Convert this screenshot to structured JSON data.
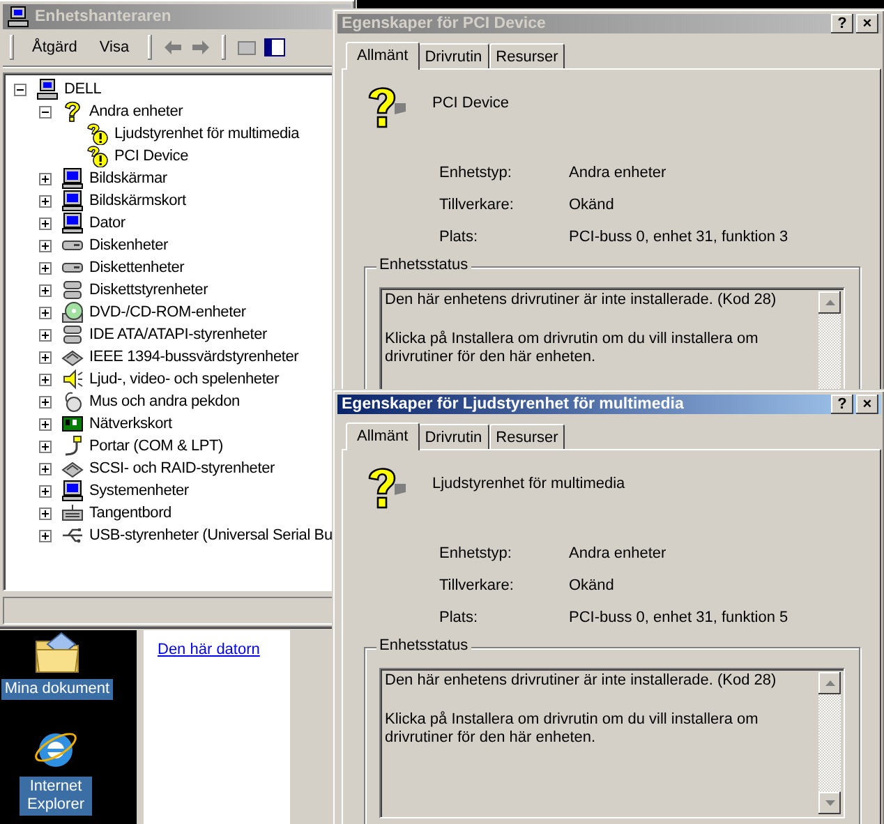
{
  "desktop_icons": [
    {
      "label": "Mina dokument",
      "kind": "documents",
      "selected": true
    },
    {
      "label": "Internet Explorer",
      "kind": "browser",
      "selected": true
    }
  ],
  "background_window": {
    "links": [
      "Den här datorn"
    ]
  },
  "device_manager": {
    "title": "Enhetshanteraren",
    "active": false,
    "menu": [
      "Åtgärd",
      "Visa"
    ],
    "tree": {
      "label": "DELL",
      "kind": "computer",
      "expanded": true,
      "children": [
        {
          "label": "Andra enheter",
          "kind": "question",
          "expanded": true,
          "children": [
            {
              "label": "Ljudstyrenhet för multimedia",
              "kind": "warning"
            },
            {
              "label": "PCI Device",
              "kind": "warning"
            }
          ]
        },
        {
          "label": "Bildskärmar",
          "kind": "monitor",
          "expanded": false
        },
        {
          "label": "Bildskärmskort",
          "kind": "monitor",
          "expanded": false
        },
        {
          "label": "Dator",
          "kind": "monitor",
          "expanded": false
        },
        {
          "label": "Diskenheter",
          "kind": "drive",
          "expanded": false
        },
        {
          "label": "Diskettenheter",
          "kind": "drive",
          "expanded": false
        },
        {
          "label": "Diskettstyrenheter",
          "kind": "controller",
          "expanded": false
        },
        {
          "label": "DVD-/CD-ROM-enheter",
          "kind": "disc",
          "expanded": false
        },
        {
          "label": "IDE ATA/ATAPI-styrenheter",
          "kind": "controller",
          "expanded": false
        },
        {
          "label": "IEEE 1394-bussvärdstyrenheter",
          "kind": "card",
          "expanded": false
        },
        {
          "label": "Ljud-, video- och spelenheter",
          "kind": "speaker",
          "expanded": false
        },
        {
          "label": "Mus och andra pekdon",
          "kind": "mouse",
          "expanded": false
        },
        {
          "label": "Nätverkskort",
          "kind": "network",
          "expanded": false
        },
        {
          "label": "Portar (COM & LPT)",
          "kind": "plug",
          "expanded": false
        },
        {
          "label": "SCSI- och RAID-styrenheter",
          "kind": "card",
          "expanded": false
        },
        {
          "label": "Systemenheter",
          "kind": "monitor",
          "expanded": false
        },
        {
          "label": "Tangentbord",
          "kind": "keyboard",
          "expanded": false
        },
        {
          "label": "USB-styrenheter (Universal Serial Bu",
          "kind": "usb",
          "expanded": false
        }
      ]
    }
  },
  "properties_windows": [
    {
      "title": "Egenskaper för PCI Device",
      "active": false,
      "title_buttons": [
        "?",
        "×"
      ],
      "tabs": [
        {
          "label": "Allmänt",
          "selected": true
        },
        {
          "label": "Drivrutin",
          "selected": false
        },
        {
          "label": "Resurser",
          "selected": false
        }
      ],
      "device_name": "PCI Device",
      "fields": [
        {
          "label": "Enhetstyp:",
          "value": "Andra enheter"
        },
        {
          "label": "Tillverkare:",
          "value": "Okänd"
        },
        {
          "label": "Plats:",
          "value": "PCI-buss 0, enhet 31, funktion 3"
        }
      ],
      "status_group": "Enhetsstatus",
      "status_text": [
        "Den här enhetens drivrutiner är inte installerade. (Kod 28)",
        "Klicka på Installera om drivrutin om du vill installera om drivrutiner för den här enheten."
      ]
    },
    {
      "title": "Egenskaper för Ljudstyrenhet för multimedia",
      "active": true,
      "title_buttons": [
        "?",
        "×"
      ],
      "tabs": [
        {
          "label": "Allmänt",
          "selected": true
        },
        {
          "label": "Drivrutin",
          "selected": false
        },
        {
          "label": "Resurser",
          "selected": false
        }
      ],
      "device_name": "Ljudstyrenhet för multimedia",
      "fields": [
        {
          "label": "Enhetstyp:",
          "value": "Andra enheter"
        },
        {
          "label": "Tillverkare:",
          "value": "Okänd"
        },
        {
          "label": "Plats:",
          "value": "PCI-buss 0, enhet 31, funktion 5"
        }
      ],
      "status_group": "Enhetsstatus",
      "status_text": [
        "Den här enhetens drivrutiner är inte installerade. (Kod 28)",
        "Klicka på Installera om drivrutin om du vill installera om drivrutiner för den här enheten."
      ]
    }
  ]
}
